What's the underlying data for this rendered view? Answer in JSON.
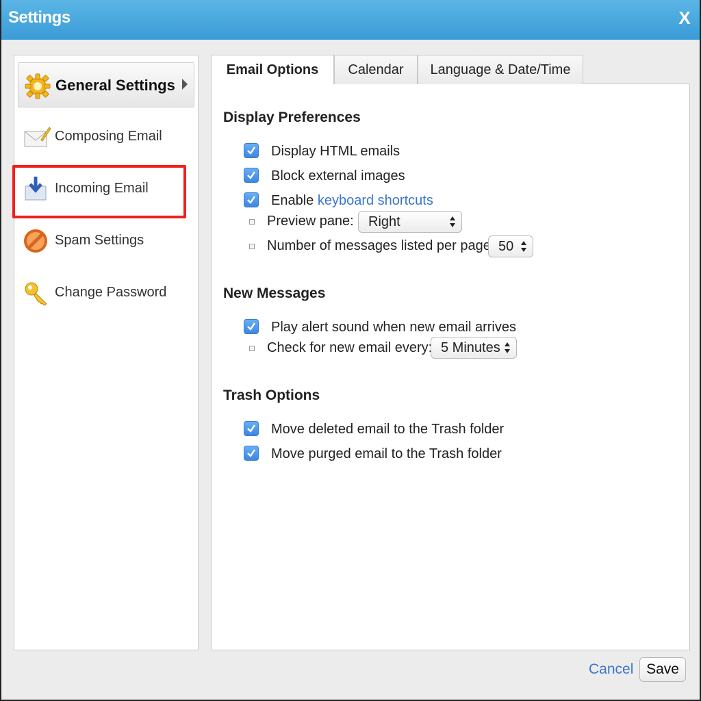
{
  "window": {
    "title": "Settings",
    "close_label": "X"
  },
  "sidebar": {
    "items": [
      {
        "label": "General Settings",
        "icon": "gear-icon"
      },
      {
        "label": "Composing Email",
        "icon": "envelope-pencil-icon"
      },
      {
        "label": "Incoming Email",
        "icon": "incoming-arrow-icon"
      },
      {
        "label": "Spam Settings",
        "icon": "no-entry-icon"
      },
      {
        "label": "Change Password",
        "icon": "key-icon"
      }
    ],
    "active_index": 0,
    "highlighted_index": 2
  },
  "tabs": [
    {
      "label": "Email Options"
    },
    {
      "label": "Calendar"
    },
    {
      "label": "Language & Date/Time"
    }
  ],
  "active_tab": 0,
  "display_preferences": {
    "title": "Display Preferences",
    "display_html": {
      "label": "Display HTML emails",
      "checked": true
    },
    "block_images": {
      "label": "Block external images",
      "checked": true
    },
    "keyboard": {
      "label": "Enable",
      "link": "keyboard shortcuts",
      "checked": true
    },
    "preview_pane": {
      "label": "Preview pane:",
      "value": "Right"
    },
    "messages_per_page": {
      "label": "Number of messages listed per page:",
      "value": "50"
    }
  },
  "new_messages": {
    "title": "New Messages",
    "alert_sound": {
      "label": "Play alert sound when new email arrives",
      "checked": true
    },
    "check_every": {
      "label": "Check for new email every:",
      "value": "5 Minutes"
    }
  },
  "trash_options": {
    "title": "Trash Options",
    "move_deleted": {
      "label": "Move deleted email to the Trash folder",
      "checked": true
    },
    "move_purged": {
      "label": "Move purged email to the Trash folder",
      "checked": true
    }
  },
  "footer": {
    "cancel_label": "Cancel",
    "save_label": "Save"
  },
  "colors": {
    "titlebar": "#3b9bd6",
    "link": "#3a76c8",
    "checkbox": "#4a8fe8",
    "highlight": "#f0201a"
  }
}
